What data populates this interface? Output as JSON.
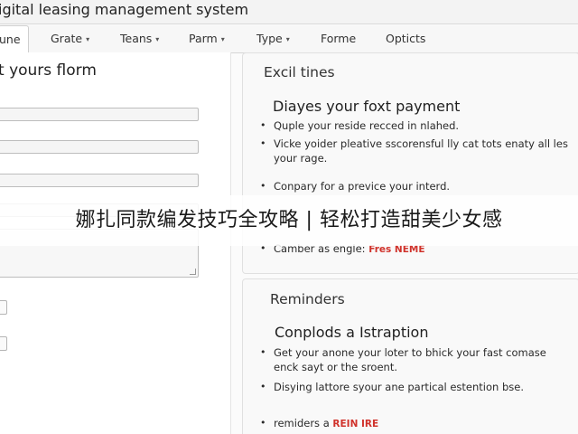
{
  "app": {
    "title": "igital leasing management system"
  },
  "nav": {
    "items": [
      {
        "label": "une",
        "has_caret": false,
        "active": true
      },
      {
        "label": "Grate",
        "has_caret": true
      },
      {
        "label": "Teans",
        "has_caret": true
      },
      {
        "label": "Parm",
        "has_caret": true
      },
      {
        "label": "Type",
        "has_caret": true
      },
      {
        "label": "Forme",
        "has_caret": false
      },
      {
        "label": "Opticts",
        "has_caret": false
      }
    ],
    "caret_glyph": "▾"
  },
  "form": {
    "heading": "t yours florm"
  },
  "cards": {
    "excil": {
      "title": "Excil tines",
      "subtitle": "Diayes your foxt payment",
      "bullets": [
        "Quple your reside recced in nlahed.",
        "Vicke yoider pleative sscorensful lly cat tots enaty all les your rage.",
        "Conpary for a previce your interd."
      ],
      "last_bullet_prefix": "Camber as engle: ",
      "last_bullet_highlight": "Fres NEME"
    },
    "reminders": {
      "title": "Reminders",
      "subtitle": "Conplods a Istraption",
      "bullets": [
        "Get your anone your loter to bhick your fast comase enck sayt or the sroent.",
        "Disying lattore syour ane partical estention bse."
      ],
      "last_bullet_prefix": "remiders a ",
      "last_bullet_highlight": "REIN IRE"
    }
  },
  "caption": {
    "text": "娜扎同款编发技巧全攻略 | 轻松打造甜美少女感"
  },
  "colors": {
    "accent_red": "#d0322b",
    "panel_bg": "#f9f9f9",
    "nav_bg": "#f7f7f7"
  }
}
